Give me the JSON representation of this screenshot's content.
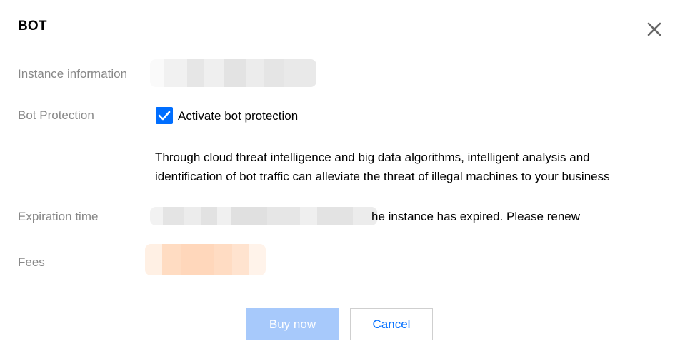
{
  "dialog": {
    "title": "BOT"
  },
  "fields": {
    "instance": {
      "label": "Instance information"
    },
    "bot_protection": {
      "label": "Bot Protection",
      "checkbox_label": "Activate bot protection",
      "checked": true,
      "description_line1": "Through cloud threat intelligence and big data algorithms, intelligent analysis and",
      "description_line2": "identification of bot traffic can alleviate the threat of illegal machines to your business"
    },
    "expiration": {
      "label": "Expiration time",
      "note": "he instance has expired. Please renew"
    },
    "fees": {
      "label": "Fees"
    }
  },
  "footer": {
    "buy_label": "Buy now",
    "cancel_label": "Cancel"
  },
  "colors": {
    "accent": "#006eff",
    "buy_disabled_bg": "#a7c9fb",
    "label_gray": "#888888",
    "fee_blur": "#ffd9bf"
  },
  "icons": {
    "close": "close-icon",
    "checkbox": "checkmark-icon"
  }
}
